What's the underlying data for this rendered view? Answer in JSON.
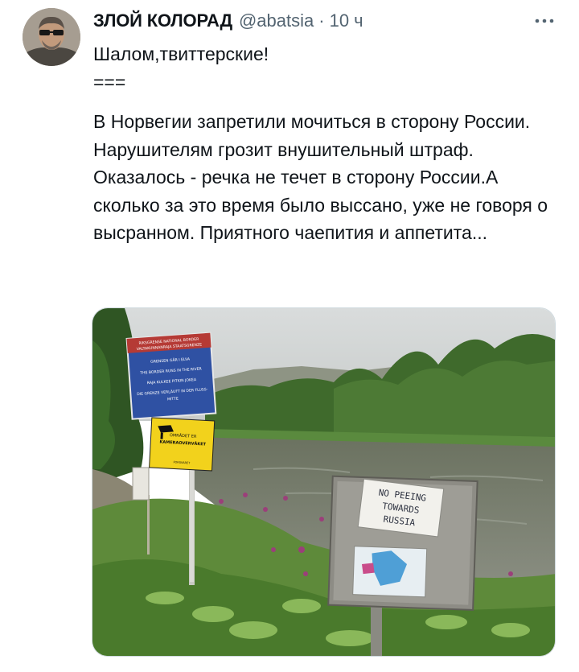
{
  "tweet": {
    "author_name": "ЗЛОЙ КОЛОРАД",
    "handle": "@abatsia",
    "separator": "·",
    "timestamp": "10 ч",
    "more_icon": "more-horizontal-icon",
    "lines": [
      "Шалом,твиттерские!",
      "===",
      "В Норвегии запретили мочиться в сторону России.",
      "Нарушителям грозит внушительный штраф. Оказалось - речка не течет в сторону России.А сколько за это время было выссано, уже не говоря о высранном. Приятного чаепития и аппетита..."
    ]
  },
  "photo": {
    "blue_sign_lines": [
      "RIKSGRENSE  NATIONAL BORDER",
      "VALTAKUNNANRAJA  STAATSGRENZE",
      "GRENSEN GÅR I ELVA",
      "THE BORDER RUNS IN THE RIVER",
      "RAJA KULKEE PITKIN JOKEA",
      "DIE GRENZE VERLÄUFT IN DER FLUSS-",
      "MITTE"
    ],
    "yellow_sign_lines": [
      "OMRÅDET ER",
      "KAMERAOVERVÅKET",
      "FORSVARET"
    ],
    "note_lines": [
      "NO PEEING",
      "TOWARDS",
      "RUSSIA"
    ]
  }
}
